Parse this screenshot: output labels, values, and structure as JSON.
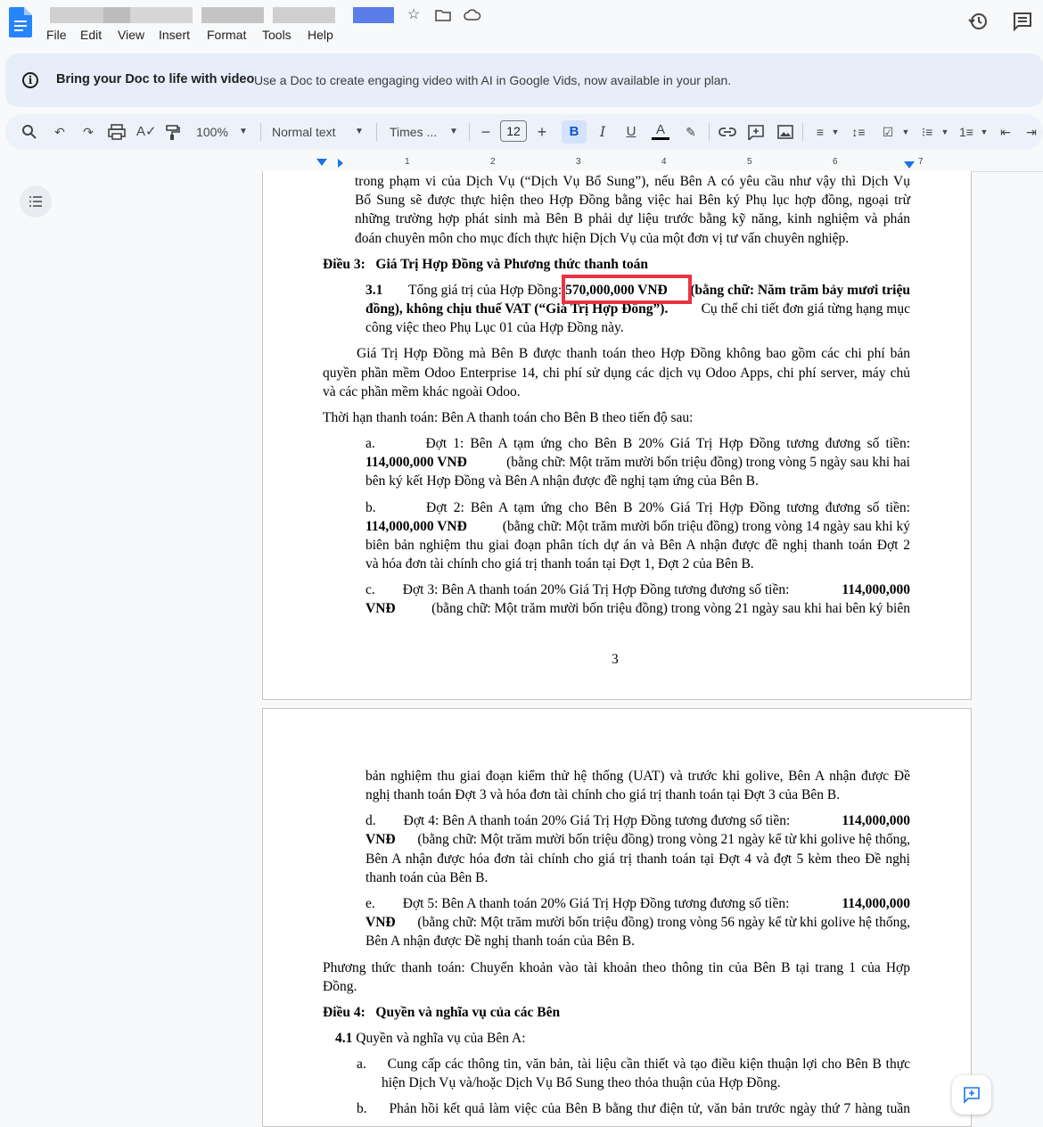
{
  "menu": [
    "File",
    "Edit",
    "View",
    "Insert",
    "Format",
    "Tools",
    "Help"
  ],
  "banner": {
    "title": "Bring your Doc to life with video",
    "text": "Use a Doc to create engaging video with AI in Google Vids, now available in your plan."
  },
  "toolbar": {
    "zoom": "100%",
    "style": "Normal text",
    "font": "Times ...",
    "font_size": "12"
  },
  "ruler": [
    "1",
    "2",
    "3",
    "4",
    "5",
    "6",
    "7"
  ],
  "page1": {
    "l1": "trong phạm vi của Dịch Vụ (“Dịch Vụ Bổ Sung”), nếu Bên A có yêu cầu như vậy thì Dịch Vụ",
    "l2": "Bổ Sung sẽ được thực hiện theo Hợp Đồng bằng việc hai Bên ký Phụ lục hợp đồng, ngoại trừ",
    "l3": "những trường hợp phát sinh mà Bên B phải dự liệu trước bằng kỹ năng, kinh nghiệm và phán",
    "l4": "đoán chuyên môn cho mục đích thực hiện Dịch Vụ của một đơn vị tư vấn chuyên nghiệp.",
    "art3": "Điều 3:   Giá Trị Hợp Đồng và Phương thức thanh toán",
    "s31_num": "3.1",
    "s31_l1a": "Tổng giá trị của Hợp Đồng: ",
    "s31_amount": "570,000,000 VNĐ",
    "s31_l1b": " (bằng chữ: Năm trăm bảy mươi triệu",
    "s31_l2a": "đồng), không chịu thuế VAT (“Giá Trị Hợp Đồng”).",
    "s31_l2b": " Cụ thể chi tiết đơn giá từng hạng mục",
    "s31_l3": "công việc theo Phụ Lục 01 của Hợp Đồng này.",
    "p2_l1": "Giá Trị Hợp Đồng mà Bên B được thanh toán theo Hợp Đồng không bao gồm các chi phí bản",
    "p2_l2": "quyền phần mềm Odoo Enterprise 14, chi phí sử dụng các dịch vụ Odoo Apps, chi phí server, máy chủ",
    "p2_l3": "và các phần mềm khác ngoài Odoo.",
    "p3": "Thời hạn thanh toán: Bên A thanh toán cho Bên B theo tiến độ sau:",
    "a_l1": "a.        Đợt 1: Bên A tạm ứng cho Bên B 20% Giá Trị Hợp Đồng tương đương số tiền:",
    "a_amount": "114,000,000 VNĐ",
    "a_l2": " (bằng chữ: Một trăm mười bốn triệu đồng) trong vòng 5 ngày sau khi hai",
    "a_l3": "bên ký kết Hợp Đồng và Bên A nhận được đề nghị tạm ứng của Bên B.",
    "b_l1": "b.        Đợt 2: Bên A tạm ứng cho Bên B 20% Giá Trị Hợp Đồng tương đương số tiền:",
    "b_amount": "114,000,000 VNĐ",
    "b_l2": " (bằng chữ: Một trăm mười bốn triệu đồng) trong vòng 14 ngày sau khi ký",
    "b_l3": "biên bản nghiệm thu giai đoạn phân tích dự án và Bên A nhận được đề nghị thanh toán Đợt 2",
    "b_l4": "và hóa đơn tài chính cho giá trị thanh toán tại Đợt 1, Đợt 2 của Bên B.",
    "c_l1": "c.        Đợt 3: Bên A thanh toán 20% Giá Trị Hợp Đồng tương đương số tiền: ",
    "c_amount1": "114,000,000",
    "c_amount2": "VNĐ",
    "c_l2": " (bằng chữ: Một trăm mười bốn triệu đồng) trong vòng 21 ngày sau khi hai bên ký biên",
    "page_number": "3"
  },
  "page2": {
    "c_l3": "bản nghiệm thu giai đoạn kiểm thử hệ thống (UAT) và trước khi golive, Bên A nhận được Đề",
    "c_l4": "nghị thanh toán Đợt 3 và hóa đơn tài chính cho giá trị thanh toán tại Đợt 3 của Bên B.",
    "d_l1": "d.        Đợt 4: Bên A thanh toán 20% Giá Trị Hợp Đồng tương đương số tiền: ",
    "d_amount1": "114,000,000",
    "d_amount2": "VNĐ",
    "d_l2": " (bằng chữ: Một trăm mười bốn triệu đồng) trong vòng 21 ngày kể từ khi golive hệ thống,",
    "d_l3": "Bên A nhận được hóa đơn tài chính cho giá trị thanh toán tại Đợt 4 và đợt 5 kèm theo Đề nghị",
    "d_l4": "thanh toán của Bên B.",
    "e_l1": "e.        Đợt 5: Bên A thanh toán 20% Giá Trị Hợp Đồng tương đương số tiền: ",
    "e_amount1": "114,000,000",
    "e_amount2": "VNĐ",
    "e_l2": " (bằng chữ: Một trăm mười bốn triệu đồng) trong vòng 56 ngày kể từ khi golive hệ thống,",
    "e_l3": "Bên A nhận được Đề nghị thanh toán của Bên B.",
    "pm_l1": "Phương thức thanh toán: Chuyển khoản vào tài khoản theo thông tin của Bên B tại trang 1 của Hợp",
    "pm_l2": "Đồng.",
    "art4": "Điều 4:   Quyền và nghĩa vụ của các Bên",
    "s41_num": "4.1",
    "s41": " Quyền và nghĩa vụ của Bên A:",
    "i_a_l1": "a.     Cung cấp các thông tin, văn bản, tài liệu cần thiết và tạo điều kiện thuận lợi cho Bên B thực",
    "i_a_l2": "hiện Dịch Vụ và/hoặc Dịch Vụ Bổ Sung theo thỏa thuận của Hợp Đồng.",
    "i_b_l1": "b.     Phản hồi kết quả làm việc của Bên B bằng thư điện tử, văn bản trước ngày thứ 7 hàng tuần"
  }
}
